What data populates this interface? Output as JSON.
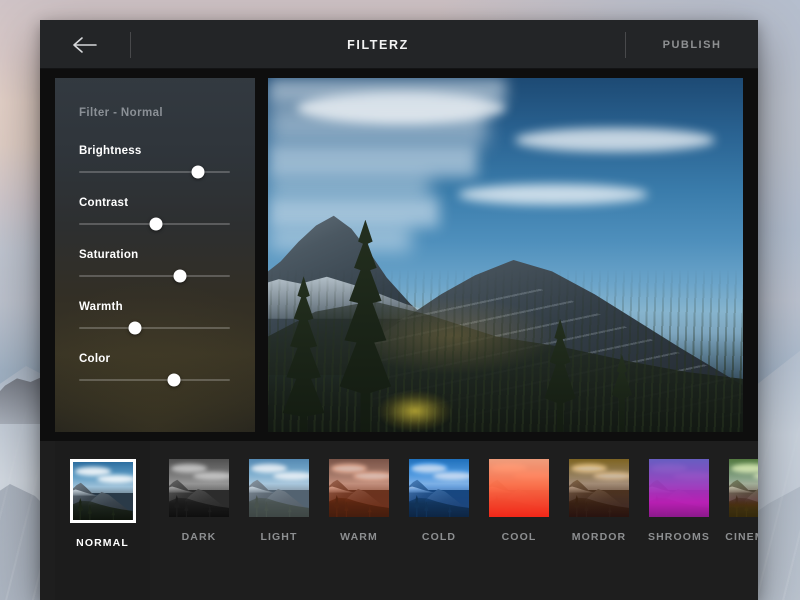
{
  "window": {
    "header": {
      "back_icon": "back-arrow-icon",
      "title": "FILTERZ",
      "publish_label": "PUBLISH"
    }
  },
  "sidebar": {
    "panel_title": "Filter - Normal",
    "sliders": [
      {
        "label": "Brightness",
        "value": 79
      },
      {
        "label": "Contrast",
        "value": 51
      },
      {
        "label": "Saturation",
        "value": 67
      },
      {
        "label": "Warmth",
        "value": 37
      },
      {
        "label": "Color",
        "value": 63
      }
    ]
  },
  "preview": {
    "alt": "mountain-landscape-photo"
  },
  "filter_strip": {
    "selected": "NORMAL",
    "filters": [
      {
        "label": "NORMAL",
        "selected": true
      },
      {
        "label": "DARK",
        "selected": false
      },
      {
        "label": "LIGHT",
        "selected": false
      },
      {
        "label": "WARM",
        "selected": false
      },
      {
        "label": "COLD",
        "selected": false
      },
      {
        "label": "COOL",
        "selected": false
      },
      {
        "label": "MORDOR",
        "selected": false
      },
      {
        "label": "SHROOMS",
        "selected": false
      },
      {
        "label": "CINEMATIC",
        "selected": false
      }
    ]
  },
  "colors": {
    "header_bg": "#232527",
    "window_bg": "#121212",
    "strip_bg": "#1e1e1e",
    "selected_pane_bg": "#1c1c1c",
    "accent_white": "#ffffff",
    "muted_text": "#8d8f91",
    "title_text": "#f2f2f2"
  }
}
